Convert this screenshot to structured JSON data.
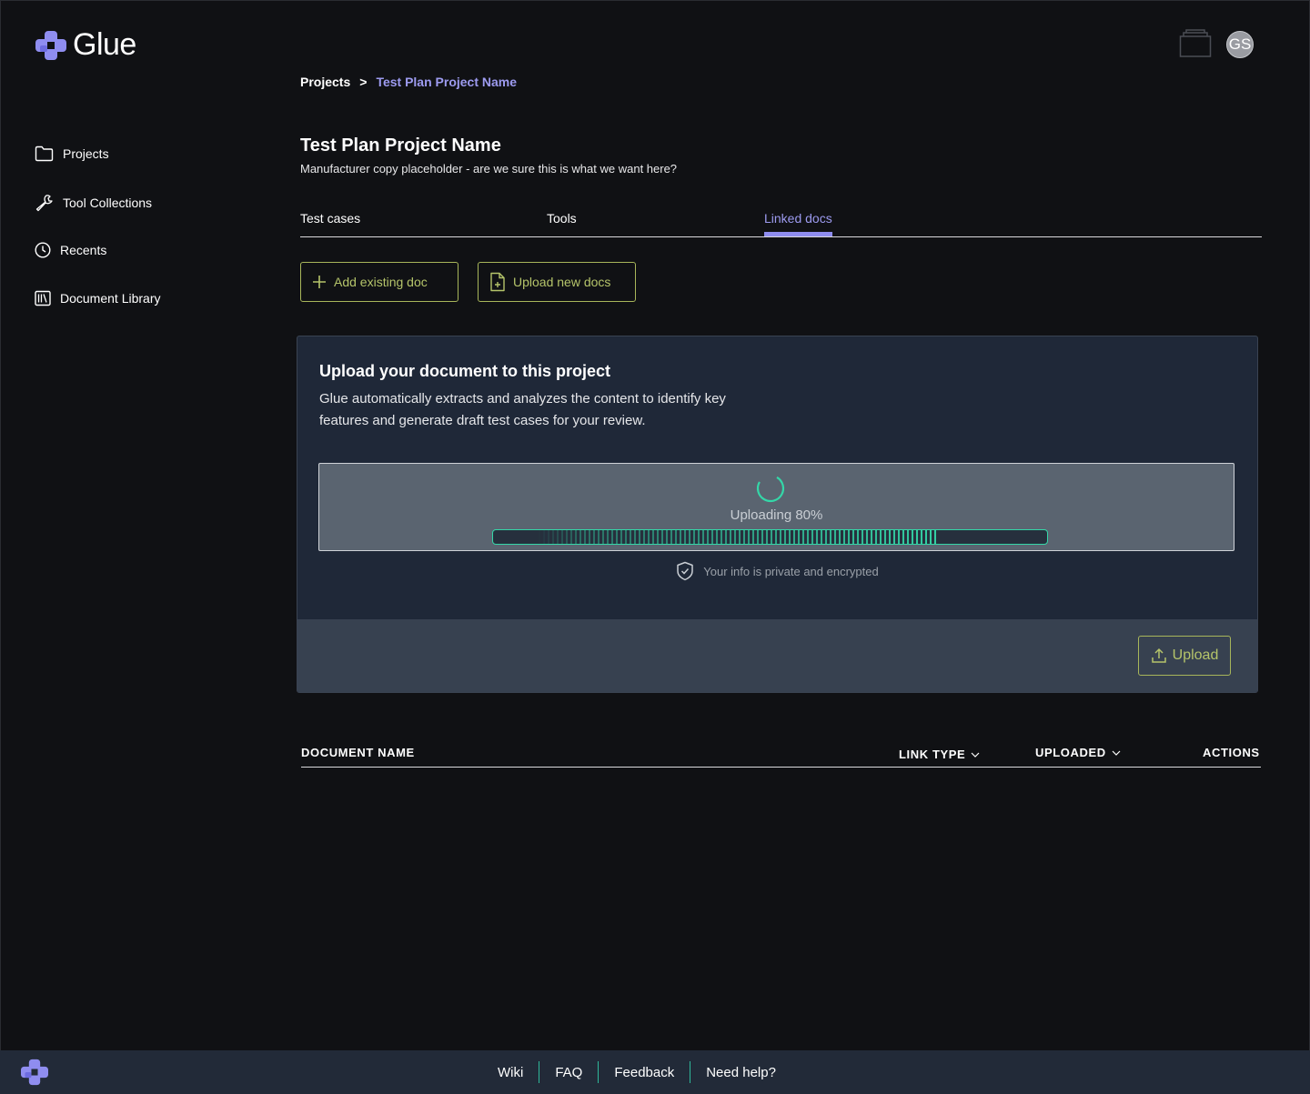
{
  "app": {
    "name": "Glue",
    "user_initials": "GS"
  },
  "colors": {
    "accent_purple": "#8f8df0",
    "accent_olive": "#b5c46a",
    "progress_green": "#34d7a8"
  },
  "breadcrumb": {
    "root": "Projects",
    "separator": ">",
    "current": "Test Plan Project Name"
  },
  "sidebar": {
    "items": [
      {
        "label": "Projects",
        "icon": "folder-icon"
      },
      {
        "label": "Tool Collections",
        "icon": "wrench-icon"
      },
      {
        "label": "Recents",
        "icon": "clock-icon"
      },
      {
        "label": "Document Library",
        "icon": "library-icon"
      }
    ]
  },
  "project": {
    "title": "Test Plan Project Name",
    "subtitle": "Manufacturer copy placeholder - are we sure this is what we want here?"
  },
  "tabs": [
    {
      "label": "Test cases",
      "active": false
    },
    {
      "label": "Tools",
      "active": false
    },
    {
      "label": "Linked docs",
      "active": true
    }
  ],
  "actions": {
    "add_existing": "Add existing doc",
    "upload_new": "Upload new docs"
  },
  "upload_panel": {
    "title": "Upload your document to this project",
    "description": "Glue automatically extracts and analyzes the content to identify key features and generate draft test cases for your review.",
    "status": "Uploading 80%",
    "progress": 0.8,
    "privacy_note": "Your info is private and encrypted",
    "upload_button": "Upload"
  },
  "table": {
    "columns": {
      "document_name": "DOCUMENT NAME",
      "link_type": "LINK TYPE",
      "uploaded": "UPLOADED",
      "actions": "ACTIONS"
    }
  },
  "footer": {
    "links": [
      "Wiki",
      "FAQ",
      "Feedback",
      "Need help?"
    ]
  }
}
